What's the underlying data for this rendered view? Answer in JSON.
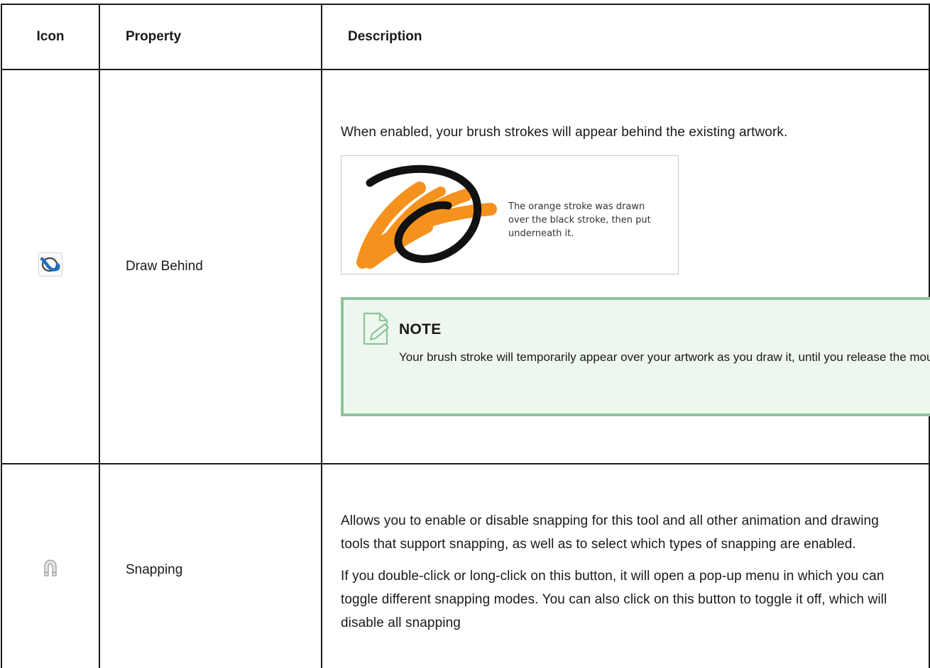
{
  "table": {
    "headers": {
      "icon": "Icon",
      "property": "Property",
      "description": "Description"
    },
    "rows": [
      {
        "icon": "draw-behind-icon",
        "property": "Draw Behind",
        "description": [
          "When enabled, your brush strokes will appear behind the existing artwork."
        ],
        "illustration": {
          "caption": "The orange stroke was drawn over the black stroke, then put underneath it.",
          "colors": {
            "orange": "#f5921e",
            "black": "#111111"
          }
        },
        "note": {
          "icon": "note-pencil-icon",
          "title": "NOTE",
          "text": "Your brush stroke will temporarily appear over your artwork as you draw it, until you release the mouse cursor or tablet pen."
        }
      },
      {
        "icon": "magnet-icon",
        "property": "Snapping",
        "description": [
          "Allows you to enable or disable snapping for this tool and all other animation and drawing tools that support snapping, as well as to select which types of snapping are enabled.",
          "If you double-click or long-click on this button, it will open a pop-up menu in which you can toggle different snapping modes. You can also click on this button to toggle it off, which will disable all snapping"
        ]
      }
    ]
  },
  "colors": {
    "note_background": "#eef7ee",
    "note_border": "#8ec39b",
    "icon_blue": "#1f6fc2"
  }
}
